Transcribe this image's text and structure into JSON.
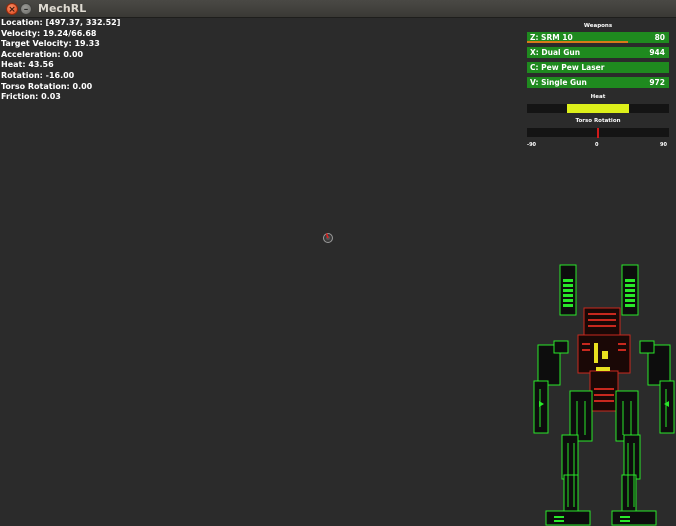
{
  "window": {
    "title": "MechRL",
    "close_glyph": "×",
    "minimize_glyph": "–"
  },
  "stats": [
    "Location: [497.37, 332.52]",
    "Velocity: 19.24/66.68",
    "Target Velocity: 19.33",
    "Acceleration: 0.00",
    "Heat: 43.56",
    "Rotation: -16.00",
    "Torso Rotation: 0.00",
    "Friction: 0.03"
  ],
  "hud": {
    "weapons_title": "Weapons",
    "weapons": [
      {
        "name": "Z: SRM 10",
        "value": "80",
        "reload_fraction": 0.71
      },
      {
        "name": "X: Dual Gun",
        "value": "944"
      },
      {
        "name": "C: Pew Pew Laser",
        "value": ""
      },
      {
        "name": "V: Single Gun",
        "value": "972"
      }
    ],
    "heat_title": "Heat",
    "heat_fill_start": 0.28,
    "heat_fill_end": 0.72,
    "torso_title": "Torso Rotation",
    "torso_ticks": {
      "min": "-90",
      "mid": "0",
      "max": "90"
    },
    "torso_value": 0
  },
  "colors": {
    "background": "#2b2b2b",
    "weapon_bar": "#1f8a1f",
    "reload": "#d87a18",
    "heat": "#ddf01a",
    "needle": "#d01a1a",
    "mech_outline": "#29e829",
    "mech_damaged": "#c8281e",
    "mech_critical": "#e8e020"
  }
}
